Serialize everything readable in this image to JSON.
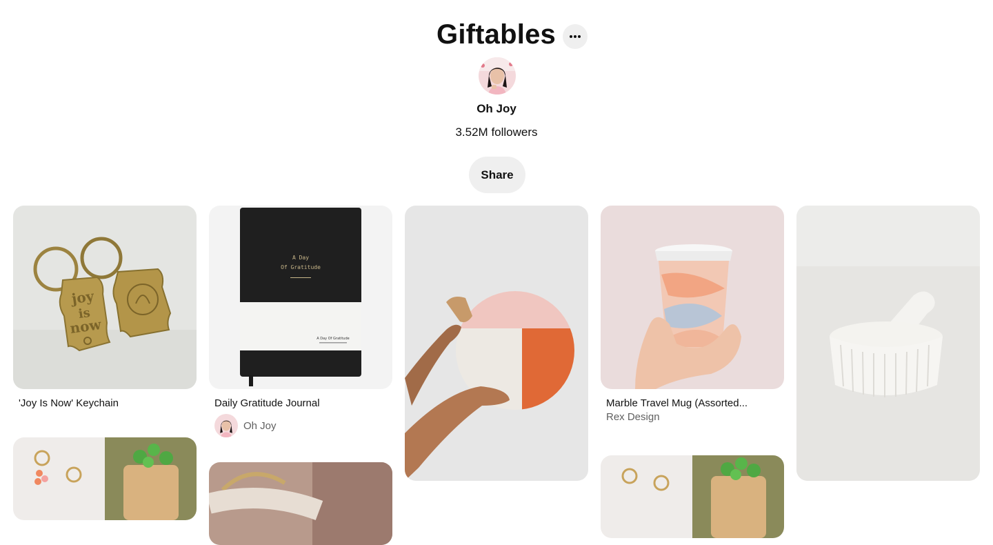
{
  "board": {
    "title": "Giftables",
    "more_icon": "ellipsis-icon",
    "owner": {
      "name": "Oh Joy",
      "followers": "3.52M followers"
    },
    "share_label": "Share"
  },
  "pins": [
    {
      "title": "'Joy Is Now' Keychain",
      "image": "brass keychains"
    },
    {
      "title": "Daily Gratitude Journal",
      "creator": "Oh Joy",
      "image": "black journal",
      "cover_line1": "A Day",
      "cover_line2": "Of Gratitude",
      "band_text": "A Day Of Gratitude"
    },
    {
      "title": "",
      "image": "round cutting board"
    },
    {
      "title": "Marble Travel Mug (Assorted...",
      "subtitle": "Rex Design",
      "image": "marble travel mug"
    },
    {
      "title": "",
      "image": "marble mortar and pestle"
    },
    {
      "title": "",
      "image": "earrings and planter"
    },
    {
      "title": "",
      "image": "woven basket"
    },
    {
      "title": "",
      "image": "earrings and planter"
    }
  ]
}
